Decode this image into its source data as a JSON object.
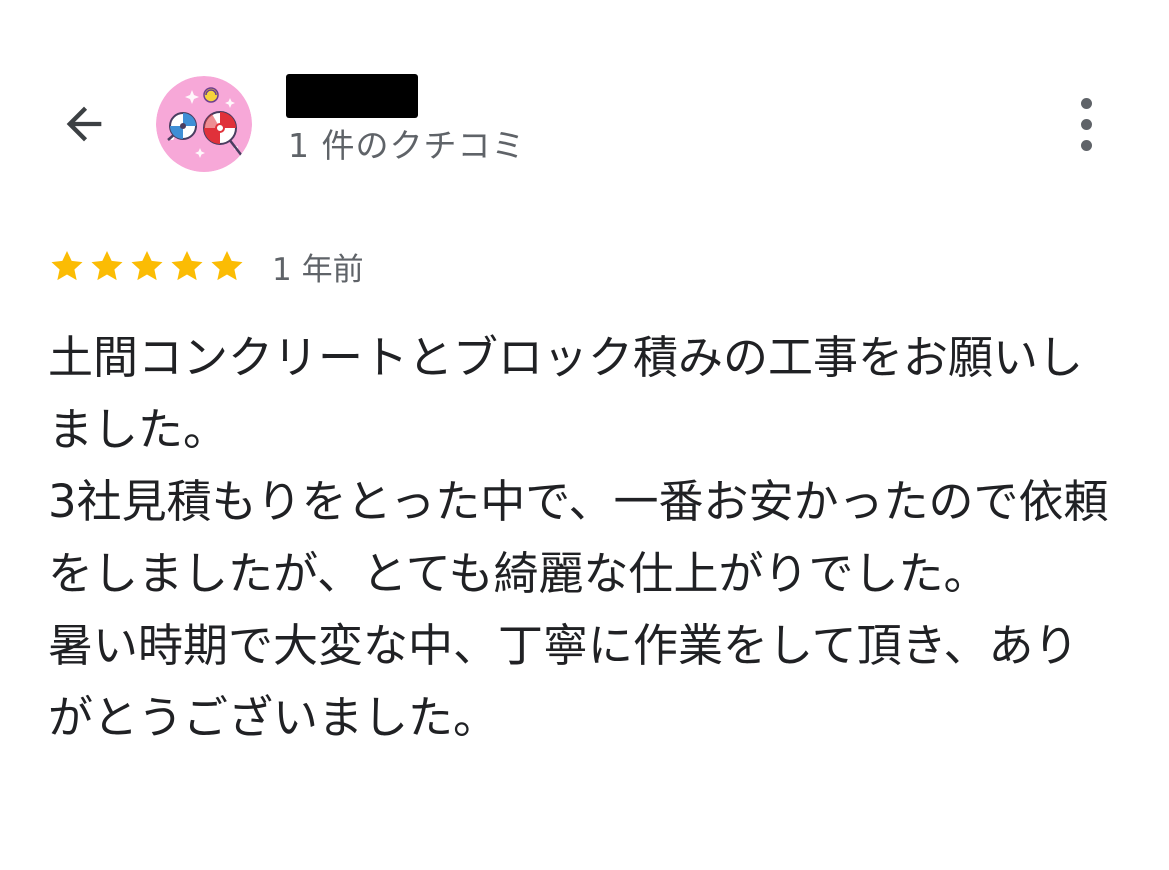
{
  "header": {
    "reviewer_name": "",
    "review_count": "1 件のクチコミ",
    "back_icon": "arrow-back-icon",
    "more_icon": "more-vert-icon"
  },
  "review": {
    "rating": 5,
    "rating_max": 5,
    "date": "1 年前",
    "paragraphs": [
      "土間コンクリートとブロック積みの工事をお願いしました。",
      "3社見積もりをとった中で、一番お安かったので依頼をしましたが、とても綺麗な仕上がりでした。",
      "暑い時期で大変な中、丁寧に作業をして頂き、ありがとうございました。"
    ]
  },
  "colors": {
    "star": "#fbbc04",
    "secondary_text": "#5f6368",
    "primary_text": "#202124",
    "avatar_bg": "#f7a8d8"
  }
}
